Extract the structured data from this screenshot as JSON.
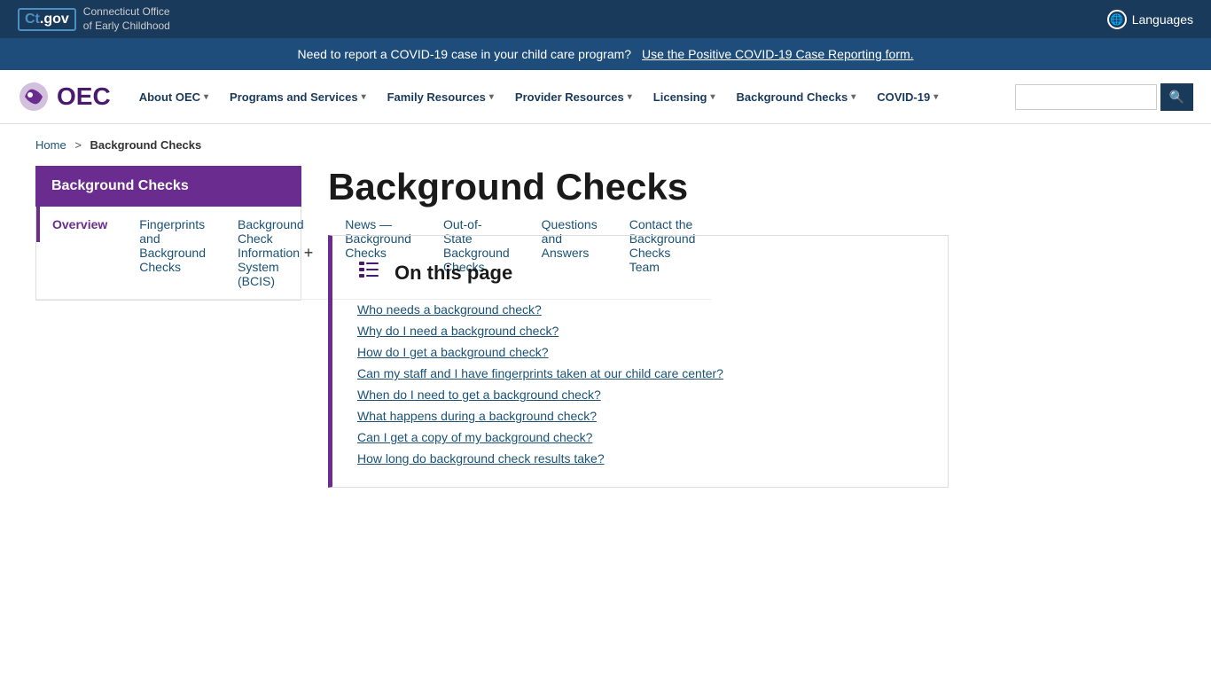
{
  "govBar": {
    "ctGovLabel": "Ct",
    "ctGovDomain": ".gov",
    "agencyLine1": "Connecticut Office",
    "agencyLine2": "of Early Childhood",
    "languagesLabel": "Languages"
  },
  "covidBanner": {
    "text": "Need to report a COVID-19 case in your child care program?",
    "linkText": "Use the Positive COVID-19 Case Reporting form."
  },
  "header": {
    "logoText": "OEC",
    "nav": [
      {
        "label": "About OEC",
        "hasDropdown": true
      },
      {
        "label": "Programs and Services",
        "hasDropdown": true
      },
      {
        "label": "Family Resources",
        "hasDropdown": true
      },
      {
        "label": "Provider Resources",
        "hasDropdown": true
      },
      {
        "label": "Licensing",
        "hasDropdown": true
      },
      {
        "label": "Background Checks",
        "hasDropdown": true
      },
      {
        "label": "COVID-19",
        "hasDropdown": true
      }
    ],
    "searchPlaceholder": ""
  },
  "breadcrumb": {
    "homeLabel": "Home",
    "currentLabel": "Background Checks"
  },
  "sidebar": {
    "title": "Background Checks",
    "items": [
      {
        "label": "Overview",
        "active": true,
        "hasExpand": false
      },
      {
        "label": "Fingerprints and Background Checks",
        "active": false,
        "hasExpand": false
      },
      {
        "label": "Background Check Information System (BCIS)",
        "active": false,
        "hasExpand": true
      },
      {
        "label": "News — Background Checks",
        "active": false,
        "hasExpand": false
      },
      {
        "label": "Out-of-State Background Checks",
        "active": false,
        "hasExpand": false
      },
      {
        "label": "Questions and Answers",
        "active": false,
        "hasExpand": false
      },
      {
        "label": "Contact the Background Checks Team",
        "active": false,
        "hasExpand": false
      }
    ]
  },
  "mainContent": {
    "pageTitle": "Background Checks",
    "onThisPage": {
      "title": "On this page",
      "links": [
        "Who needs a background check?",
        "Why do I need a background check?",
        "How do I get a background check?",
        "Can my staff and I have fingerprints taken at our child care center?",
        "When do I need to get a background check?",
        "What happens during a background check?",
        "Can I get a copy of my background check?",
        "How long do background check results take?"
      ]
    }
  }
}
